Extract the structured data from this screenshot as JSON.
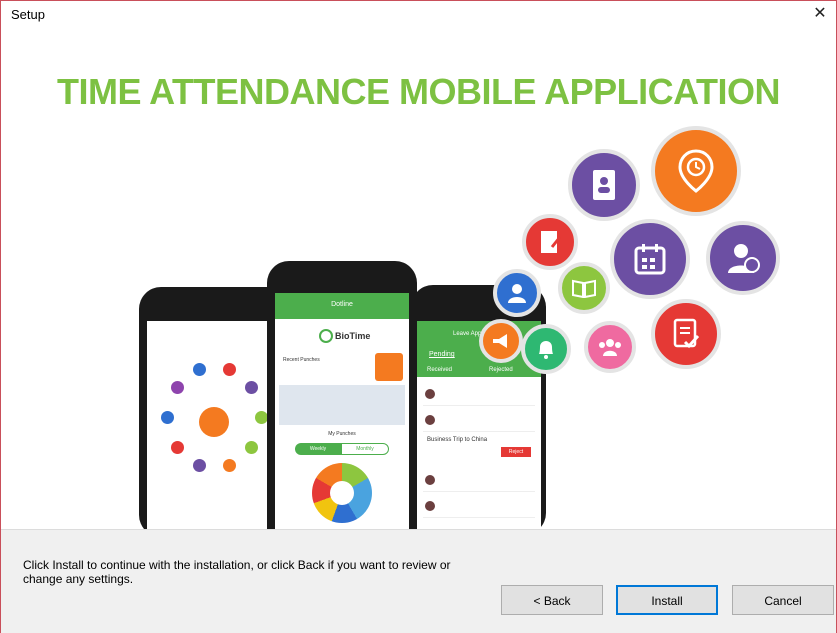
{
  "window": {
    "title": "Setup",
    "close_glyph": "✕"
  },
  "banner": {
    "headline": "TIME ATTENDANCE MOBILE APPLICATION",
    "phone_center": {
      "header": "Dotline",
      "logo": "BioTime",
      "section_label": "Recent Punches",
      "segment_left": "Weekly",
      "segment_right": "Monthly",
      "chart_label": "My Punches"
    },
    "phone_right": {
      "header": "Leave Approval",
      "tab_pending": "Pending",
      "tab_received": "Received",
      "tab_rejected": "Rejected",
      "item_title": "Business Trip to China",
      "reject_label": "Reject"
    },
    "icons": [
      "contacts-book-icon",
      "clock-location-icon",
      "edit-document-icon",
      "calendar-icon",
      "manager-clock-icon",
      "user-icon",
      "book-icon",
      "document-check-icon",
      "megaphone-icon",
      "alarm-bell-icon",
      "group-icon"
    ]
  },
  "footer": {
    "instruction": "Click Install to continue with the installation, or click Back if you want to review or change any settings.",
    "back_label": "< Back",
    "install_label": "Install",
    "cancel_label": "Cancel"
  },
  "colors": {
    "headline": "#7dc142",
    "app_green": "#4cae4c",
    "orange": "#f47a20",
    "purple": "#6c4fa3",
    "red": "#e53935",
    "blue": "#2f6fd0",
    "pink": "#ef6aa0",
    "lime": "#8dc63f"
  }
}
